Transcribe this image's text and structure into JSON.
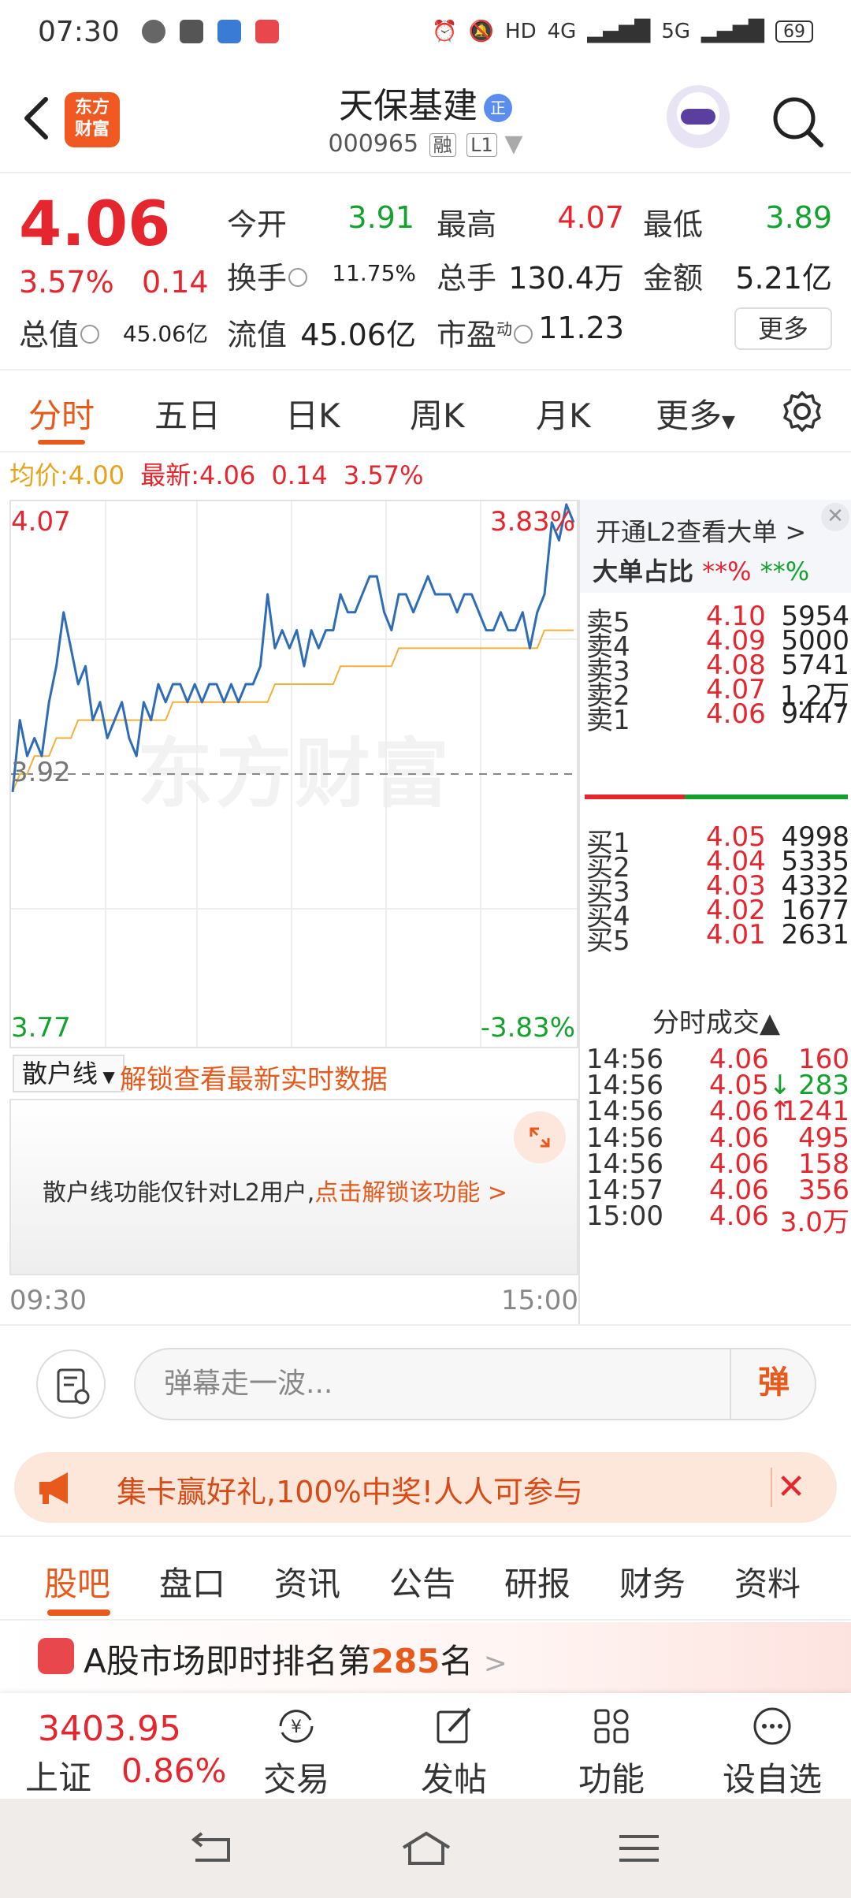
{
  "status_bar": {
    "time": "07:30",
    "network_label": "4G",
    "network2_label": "5G",
    "battery": "69",
    "hd_label": "HD"
  },
  "header": {
    "logo_text": "东方\n财富",
    "stock_name": "天保基建",
    "badge": "正",
    "stock_code": "000965",
    "tag_rong": "融",
    "tag_l1": "L1"
  },
  "quote": {
    "price": "4.06",
    "change_pct": "3.57%",
    "change_abs": "0.14",
    "open_label": "今开",
    "open_val": "3.91",
    "high_label": "最高",
    "high_val": "4.07",
    "low_label": "最低",
    "low_val": "3.89",
    "turnover_label": "换手",
    "turnover_val": "11.75%",
    "volume_label": "总手",
    "volume_val": "130.4万",
    "amount_label": "金额",
    "amount_val": "5.21亿",
    "mcap_label": "总值",
    "mcap_val": "45.06亿",
    "float_label": "流值",
    "float_val": "45.06亿",
    "pe_label": "市盈",
    "pe_sup": "动",
    "pe_val": "11.23",
    "more_label": "更多"
  },
  "tabs": [
    "分时",
    "五日",
    "日K",
    "周K",
    "月K",
    "更多"
  ],
  "avg_line": {
    "avg_label": "均价:",
    "avg_val": "4.00",
    "latest_label": "最新:",
    "latest_val": "4.06",
    "latest_chg": "0.14",
    "latest_pct": "3.57%"
  },
  "chart_data": {
    "type": "line",
    "title": "",
    "x_start": "09:30",
    "x_end": "15:00",
    "ylim": [
      3.77,
      4.07
    ],
    "y_top_label": "4.07",
    "y_mid_label": "3.92",
    "y_bottom_label": "3.77",
    "pct_top_label": "3.83%",
    "pct_bottom_label": "-3.83%",
    "prev_close": 3.92,
    "watermark": "东方财富",
    "series": [
      {
        "name": "",
        "color": "#2f6cb8",
        "values": [
          3.91,
          3.95,
          3.93,
          3.94,
          3.93,
          3.96,
          3.98,
          4.01,
          3.99,
          3.97,
          3.98,
          3.95,
          3.96,
          3.94,
          3.95,
          3.96,
          3.94,
          3.93,
          3.96,
          3.95,
          3.97,
          3.96,
          3.97,
          3.97,
          3.96,
          3.97,
          3.96,
          3.97,
          3.97,
          3.96,
          3.97,
          3.96,
          3.97,
          3.97,
          3.98,
          4.02,
          3.99,
          4.0,
          3.99,
          4.0,
          3.98,
          4.0,
          3.99,
          4.0,
          4.0,
          4.02,
          4.01,
          4.01,
          4.02,
          4.03,
          4.03,
          4.01,
          4.0,
          4.02,
          4.02,
          4.01,
          4.02,
          4.03,
          4.02,
          4.02,
          4.02,
          4.01,
          4.02,
          4.02,
          4.01,
          4.0,
          4.0,
          4.01,
          4.0,
          4.0,
          4.01,
          3.99,
          4.01,
          4.02,
          4.06,
          4.05,
          4.07,
          4.06
        ]
      },
      {
        "name": "",
        "color": "#f0b13a",
        "values": [
          3.91,
          3.92,
          3.92,
          3.93,
          3.93,
          3.93,
          3.94,
          3.94,
          3.94,
          3.95,
          3.95,
          3.95,
          3.95,
          3.95,
          3.95,
          3.95,
          3.95,
          3.95,
          3.95,
          3.95,
          3.95,
          3.95,
          3.96,
          3.96,
          3.96,
          3.96,
          3.96,
          3.96,
          3.96,
          3.96,
          3.96,
          3.96,
          3.96,
          3.96,
          3.96,
          3.96,
          3.97,
          3.97,
          3.97,
          3.97,
          3.97,
          3.97,
          3.97,
          3.97,
          3.97,
          3.98,
          3.98,
          3.98,
          3.98,
          3.98,
          3.98,
          3.98,
          3.98,
          3.99,
          3.99,
          3.99,
          3.99,
          3.99,
          3.99,
          3.99,
          3.99,
          3.99,
          3.99,
          3.99,
          3.99,
          3.99,
          3.99,
          3.99,
          3.99,
          3.99,
          3.99,
          3.99,
          3.99,
          4.0,
          4.0,
          4.0,
          4.0,
          4.0
        ]
      }
    ]
  },
  "sanhu": {
    "select_label": "散户线",
    "unlock_text": "解锁查看最新实时数据",
    "info_text": "散户线功能仅针对L2用户,",
    "info_link": "点击解锁该功能 >"
  },
  "order_book": {
    "l2_text": "开通L2查看大单 >",
    "dadan_label": "大单占比",
    "dadan_r": "**%",
    "dadan_g": "**%",
    "asks": [
      {
        "label": "卖5",
        "price": "4.10",
        "vol": "5954"
      },
      {
        "label": "卖4",
        "price": "4.09",
        "vol": "5000"
      },
      {
        "label": "卖3",
        "price": "4.08",
        "vol": "5741"
      },
      {
        "label": "卖2",
        "price": "4.07",
        "vol": "1.2万"
      },
      {
        "label": "卖1",
        "price": "4.06",
        "vol": "9447"
      }
    ],
    "bids": [
      {
        "label": "买1",
        "price": "4.05",
        "vol": "4998"
      },
      {
        "label": "买2",
        "price": "4.04",
        "vol": "5335"
      },
      {
        "label": "买3",
        "price": "4.03",
        "vol": "4332"
      },
      {
        "label": "买4",
        "price": "4.02",
        "vol": "1677"
      },
      {
        "label": "买5",
        "price": "4.01",
        "vol": "2631"
      }
    ],
    "trades_head": "分时成交▲",
    "trades": [
      {
        "time": "14:56",
        "price": "4.06",
        "vol": "160",
        "dir": "",
        "color": "red"
      },
      {
        "time": "14:56",
        "price": "4.05",
        "vol": "283",
        "dir": "↓",
        "color": "green"
      },
      {
        "time": "14:56",
        "price": "4.06",
        "vol": "1241",
        "dir": "↑",
        "color": "red"
      },
      {
        "time": "14:56",
        "price": "4.06",
        "vol": "495",
        "dir": "",
        "color": "red"
      },
      {
        "time": "14:56",
        "price": "4.06",
        "vol": "158",
        "dir": "",
        "color": "red"
      },
      {
        "time": "14:57",
        "price": "4.06",
        "vol": "356",
        "dir": "",
        "color": "red"
      },
      {
        "time": "15:00",
        "price": "4.06",
        "vol": "3.0万",
        "dir": "",
        "color": "red"
      }
    ]
  },
  "comment": {
    "placeholder": "弹幕走一波...",
    "send_label": "弹"
  },
  "promo": {
    "text": "集卡赢好礼,100%中奖!人人可参与"
  },
  "sub_tabs": [
    "股吧",
    "盘口",
    "资讯",
    "公告",
    "研报",
    "财务",
    "资料"
  ],
  "rank": {
    "prefix": "A股市场即时排名第",
    "num": "285",
    "suffix": "名",
    "arrow": ">"
  },
  "bottom_bar": {
    "index_val": "3403.95",
    "index_name": "上证",
    "index_pct": "0.86%",
    "items": [
      "交易",
      "发帖",
      "功能",
      "设自选"
    ]
  },
  "colors": {
    "up": "#e5262e",
    "down": "#14a22e",
    "accent": "#e8591c"
  }
}
